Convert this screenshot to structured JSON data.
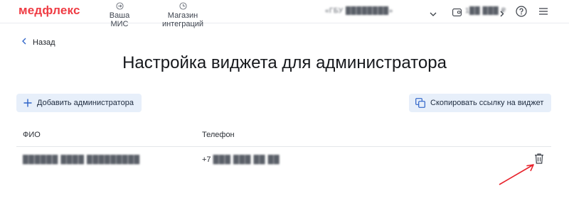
{
  "header": {
    "logo": "медфлекс",
    "nav": [
      {
        "label": "Ваша МИС",
        "icon": "login-icon"
      },
      {
        "label": "Магазин интеграций",
        "icon": "integrations-icon"
      }
    ],
    "organization": "«ГБУ ████████»",
    "balance": "1██ ███ ₽",
    "icons": [
      "chevron-down-icon",
      "wallet-icon",
      "chevron-right-icon",
      "help-icon",
      "menu-icon"
    ]
  },
  "page": {
    "back_label": "Назад",
    "title": "Настройка виджета для администратора"
  },
  "actions": {
    "add_label": "Добавить администратора",
    "copy_label": "Скопировать ссылку на виджет"
  },
  "table": {
    "columns": [
      "ФИО",
      "Телефон"
    ],
    "rows": [
      {
        "name": "██████ ████ █████████",
        "phone_prefix": "+7",
        "phone_hidden": "███ ███ ██ ██"
      }
    ]
  },
  "colors": {
    "brand": "#ef3b43",
    "button_bg": "#e7effa",
    "accent": "#2d63c8",
    "annotation_arrow": "#e8222b"
  }
}
